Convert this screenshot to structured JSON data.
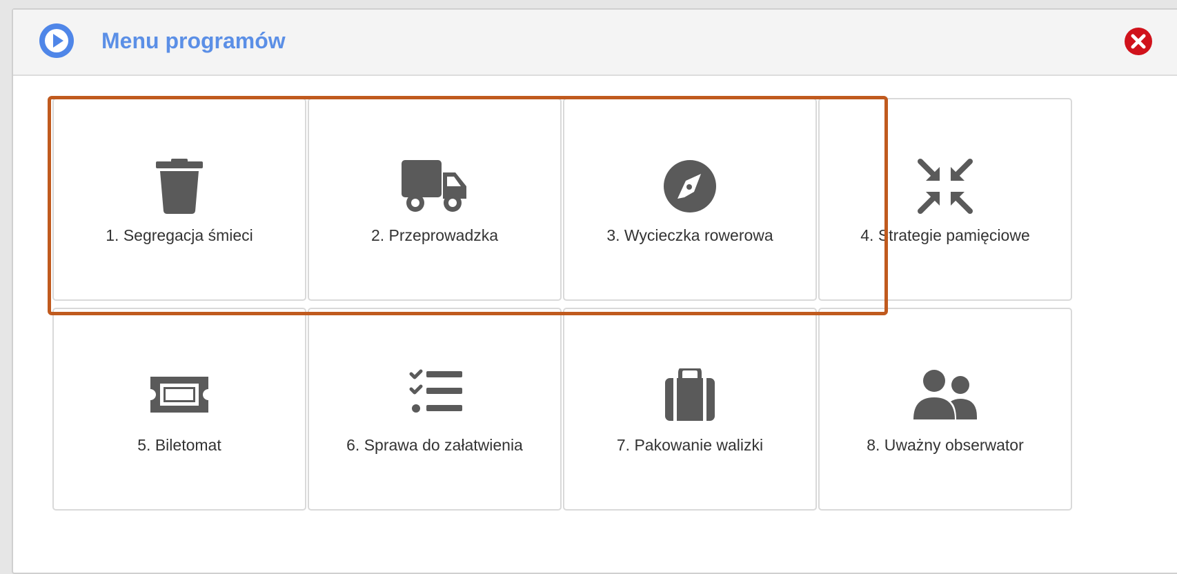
{
  "header": {
    "title": "Menu programów",
    "title_color": "#5b8fe6",
    "left_icon": "play-circle-icon",
    "close_icon": "close-circle-icon",
    "close_color": "#d0121b"
  },
  "highlight_color": "#c05a1e",
  "highlighted_tiles": [
    1,
    2,
    3
  ],
  "programs": [
    {
      "label": "1. Segregacja śmieci",
      "icon": "trash-icon"
    },
    {
      "label": "2. Przeprowadzka",
      "icon": "truck-icon"
    },
    {
      "label": "3. Wycieczka rowerowa",
      "icon": "compass-icon"
    },
    {
      "label": "4. Strategie pamięciowe",
      "icon": "compress-arrows-icon"
    },
    {
      "label": "5. Biletomat",
      "icon": "ticket-icon"
    },
    {
      "label": "6. Sprawa do załatwienia",
      "icon": "checklist-icon"
    },
    {
      "label": "7. Pakowanie walizki",
      "icon": "suitcase-icon"
    },
    {
      "label": "8. Uważny obserwator",
      "icon": "users-icon"
    }
  ]
}
